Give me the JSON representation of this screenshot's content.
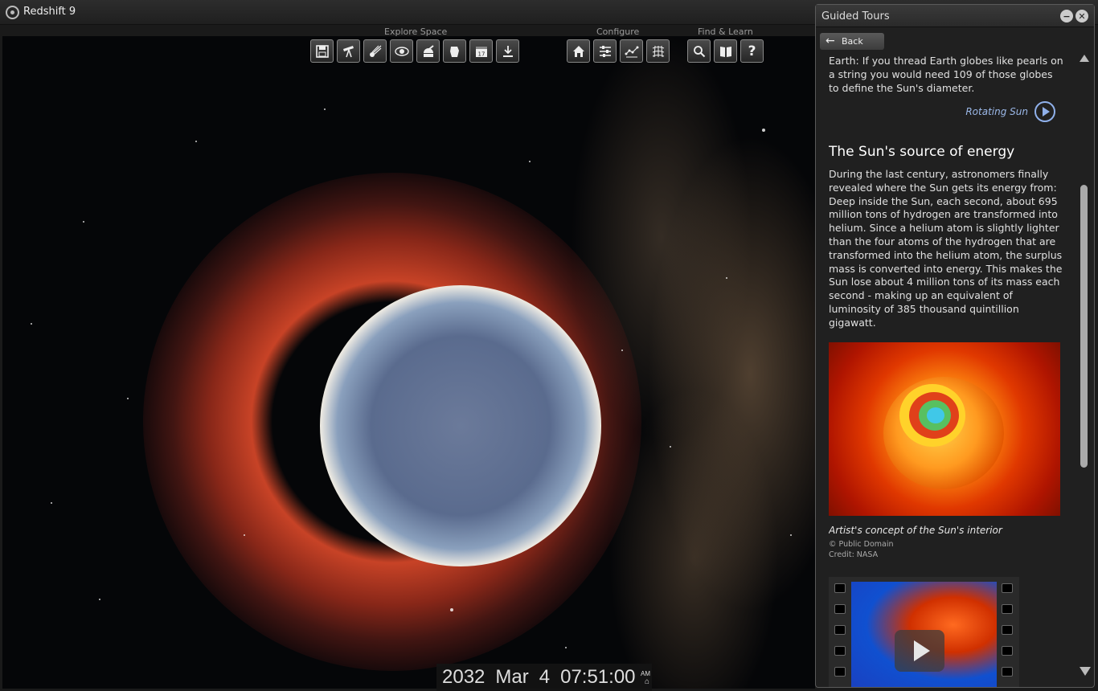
{
  "app": {
    "title": "Redshift 9"
  },
  "toolbar": {
    "groups": [
      {
        "label": "Explore Space"
      },
      {
        "label": "Configure"
      },
      {
        "label": "Find & Learn"
      }
    ],
    "buttons": [
      {
        "icon": "save-icon"
      },
      {
        "icon": "telescope-icon"
      },
      {
        "icon": "comet-icon"
      },
      {
        "icon": "orbit-eye-icon"
      },
      {
        "icon": "observatory-icon"
      },
      {
        "icon": "sky-brush-icon"
      },
      {
        "icon": "calendar-icon",
        "text": "17"
      },
      {
        "icon": "download-icon"
      },
      {
        "icon": "home-icon"
      },
      {
        "icon": "sliders-icon"
      },
      {
        "icon": "constellation-icon"
      },
      {
        "icon": "grid-icon"
      },
      {
        "icon": "search-icon"
      },
      {
        "icon": "book-icon"
      },
      {
        "icon": "help-icon",
        "text": "?"
      }
    ]
  },
  "datetime": {
    "year": "2032",
    "month": "Mar",
    "day": "4",
    "time": "07:51:00",
    "ampm": "AM"
  },
  "panel": {
    "title": "Guided Tours",
    "back_label": "Back",
    "intro_text": "Earth: If you thread Earth globes like pearls on a string you would need 109 of those globes to define the Sun's diameter.",
    "link_label": "Rotating Sun",
    "section_title": "The Sun's source of energy",
    "section_text": "During the last century, astronomers finally revealed where the Sun gets its energy from: Deep inside the Sun, each second, about 695 million tons of hydrogen are transformed into helium. Since a helium atom is slightly lighter than the four atoms of the hydrogen that are transformed into the helium atom, the surplus mass is converted into energy. This makes the Sun lose about 4 million tons of its mass each second - making up an equivalent of luminosity of 385 thousand quintillion gigawatt.",
    "image_caption": "Artist's concept of the Sun's interior",
    "image_copyright": "© Public Domain",
    "image_credit": "Credit: NASA"
  }
}
